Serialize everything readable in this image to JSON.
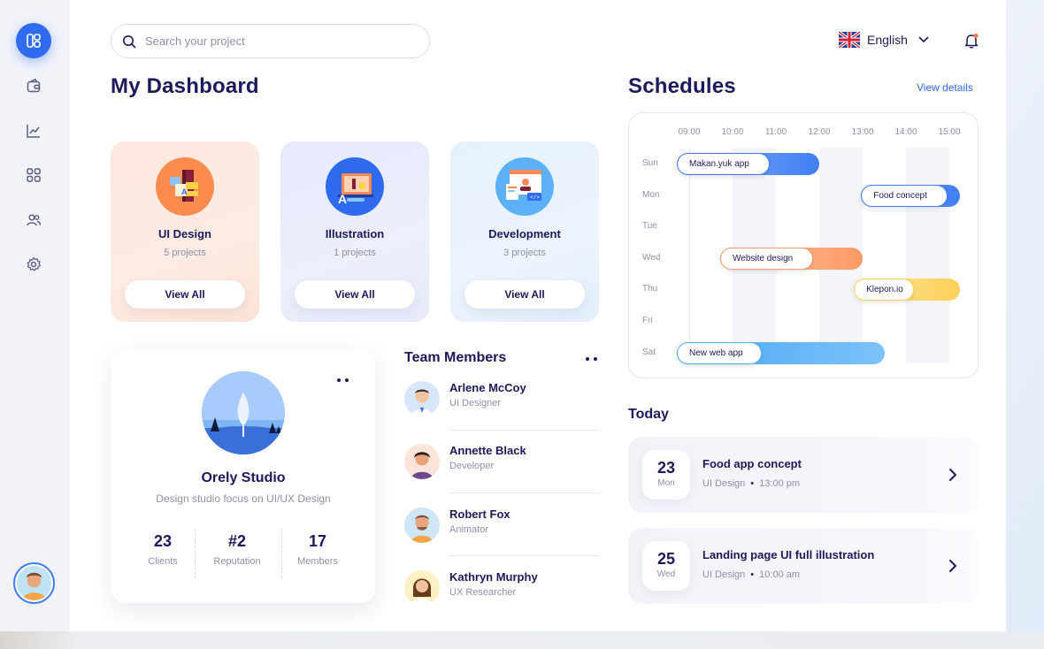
{
  "search": {
    "placeholder": "Search your project"
  },
  "header": {
    "language": "English"
  },
  "dashboard": {
    "title": "My Dashboard"
  },
  "categories": [
    {
      "title": "UI Design",
      "count": "5 projects",
      "button": "View All"
    },
    {
      "title": "Illustration",
      "count": "1 projects",
      "button": "View All"
    },
    {
      "title": "Development",
      "count": "3 projects",
      "button": "View All"
    }
  ],
  "profile": {
    "name": "Orely Studio",
    "description": "Design studio focus on UI/UX Design",
    "stats": [
      {
        "value": "23",
        "label": "Clients"
      },
      {
        "value": "#2",
        "label": "Reputation"
      },
      {
        "value": "17",
        "label": "Members"
      }
    ]
  },
  "team": {
    "title": "Team Members",
    "members": [
      {
        "name": "Arlene McCoy",
        "role": "UI Designer"
      },
      {
        "name": "Annette Black",
        "role": "Developer"
      },
      {
        "name": "Robert Fox",
        "role": "Animator"
      },
      {
        "name": "Kathryn Murphy",
        "role": "UX Researcher"
      }
    ]
  },
  "schedules": {
    "title": "Schedules",
    "view_details": "View details",
    "hours": [
      "09:00",
      "10:00",
      "11:00",
      "12:00",
      "13:00",
      "14:00",
      "15:00"
    ],
    "days": [
      "Sun",
      "Mon",
      "Tue",
      "Wed",
      "Thu",
      "Fri",
      "Sat"
    ],
    "events": [
      {
        "label": "Makan.yuk app",
        "day": "Sun",
        "start": "09:00",
        "end": "12:00"
      },
      {
        "label": "Food concept",
        "day": "Mon",
        "start": "13:15",
        "end": "15:15"
      },
      {
        "label": "Website design",
        "day": "Wed",
        "start": "10:00",
        "end": "13:00"
      },
      {
        "label": "Klepon.io",
        "day": "Thu",
        "start": "13:05",
        "end": "15:15"
      },
      {
        "label": "New web app",
        "day": "Sat",
        "start": "09:00",
        "end": "13:30"
      }
    ]
  },
  "today": {
    "title": "Today",
    "items": [
      {
        "day_num": "23",
        "weekday": "Mon",
        "title": "Food app concept",
        "category": "UI Design",
        "time": "13:00 pm"
      },
      {
        "day_num": "25",
        "weekday": "Wed",
        "title": "Landing page UI full illustration",
        "category": "UI Design",
        "time": "10:00 am"
      }
    ]
  },
  "colors": {
    "accent": "#2f6bf0",
    "ui_design_card": "#fde9e0",
    "illustration_card": "#e8ecfb",
    "development_card": "#e9f2fd",
    "bar_blue": "#3f7ef4",
    "bar_orange": "#fb9a64",
    "bar_yellow": "#fcd05a",
    "bar_lightblue": "#5cb1f6"
  },
  "icons": [
    "dashboard-icon",
    "wallet-icon",
    "chart-icon",
    "grid-icon",
    "team-icon",
    "settings-icon",
    "search-icon",
    "uk-flag-icon",
    "chevron-down-icon",
    "bell-icon",
    "chevron-right-icon"
  ]
}
